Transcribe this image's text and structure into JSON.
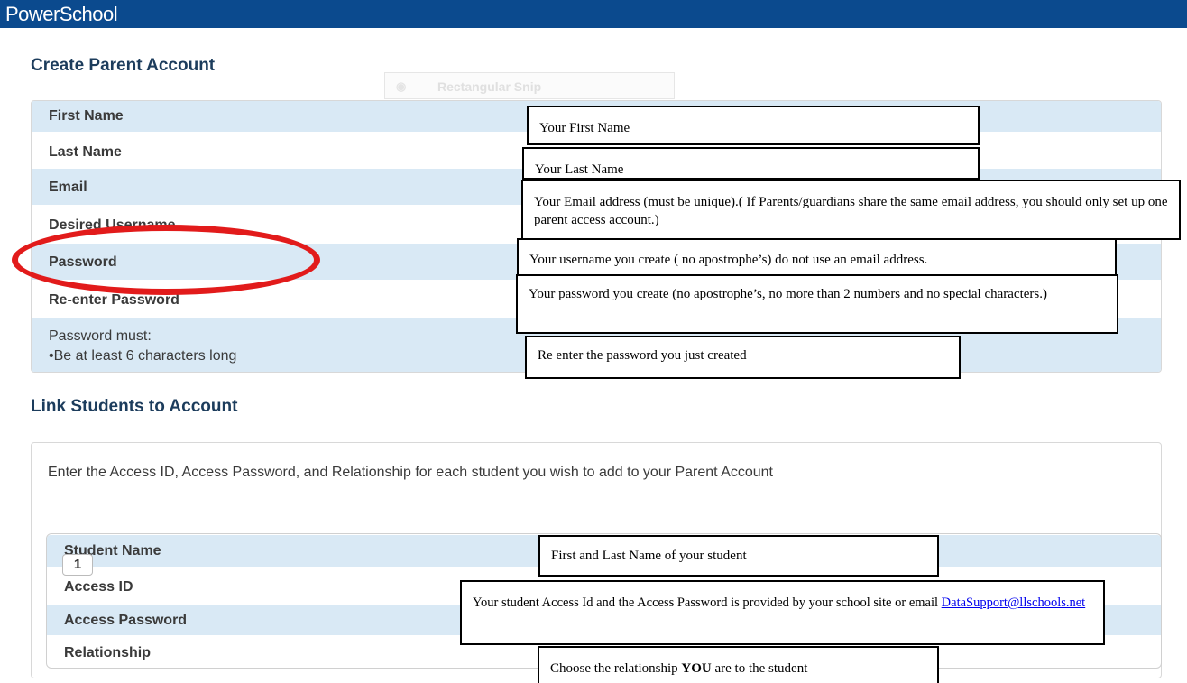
{
  "app": {
    "logo": "PowerSchool"
  },
  "snip_tool": {
    "label": "Rectangular Snip",
    "icon": "eye-icon"
  },
  "create_account": {
    "title": "Create Parent Account",
    "fields": [
      {
        "label": "First Name"
      },
      {
        "label": "Last Name"
      },
      {
        "label": "Email"
      },
      {
        "label": "Desired Username"
      },
      {
        "label": "Password"
      },
      {
        "label": "Re-enter Password"
      }
    ],
    "password_rules": {
      "heading": "Password must:",
      "rule": "•Be at least 6 characters long"
    }
  },
  "link_students": {
    "title": "Link Students to Account",
    "instructions": "Enter the Access ID, Access Password, and Relationship for each student you wish to add to your Parent Account",
    "student_number": "1",
    "fields": [
      {
        "label": "Student Name"
      },
      {
        "label": "Access ID"
      },
      {
        "label": "Access Password"
      },
      {
        "label": "Relationship"
      }
    ]
  },
  "callouts": {
    "first_name": "Your First Name",
    "last_name": "Your Last Name",
    "email": "Your Email address (must be unique).( If Parents/guardians share the same email address, you should only set up one parent access account.)",
    "username": "Your username you create ( no apostrophe’s) do not use an email address.",
    "password": "Your password you create (no apostrophe’s, no more than 2 numbers and no special characters.)",
    "reenter": "Re enter the password you just created",
    "student_name": "First and Last Name of your student",
    "access_prefix": "Your student Access Id and the Access Password is provided by your school site or email ",
    "access_email": "DataSupport@llschools.net",
    "relationship_pre": "Choose the relationship ",
    "relationship_bold": "YOU",
    "relationship_post": " are to the student"
  },
  "colors": {
    "topbar": "#0b4a8e",
    "row_shade": "#d9e9f5",
    "highlight_ellipse": "#e21b1b",
    "section_title": "#1c3c5c"
  }
}
